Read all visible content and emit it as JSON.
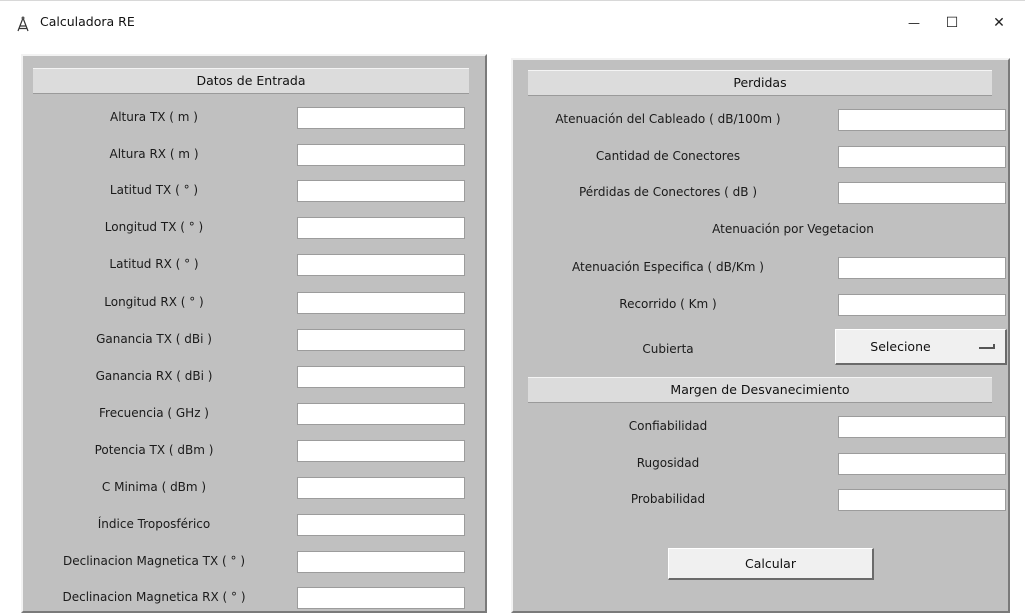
{
  "window": {
    "title": "Calculadora RE",
    "icon": "antenna-tower-icon",
    "controls": {
      "minimize": "—",
      "maximize": "☐",
      "close": "✕"
    }
  },
  "left_panel": {
    "header": "Datos de Entrada",
    "fields": [
      {
        "label": "Altura TX ( m )",
        "value": ""
      },
      {
        "label": "Altura RX ( m )",
        "value": ""
      },
      {
        "label": "Latitud TX ( ° )",
        "value": ""
      },
      {
        "label": "Longitud TX ( ° )",
        "value": ""
      },
      {
        "label": "Latitud RX ( ° )",
        "value": ""
      },
      {
        "label": "Longitud RX ( ° )",
        "value": ""
      },
      {
        "label": "Ganancia TX ( dBi )",
        "value": ""
      },
      {
        "label": "Ganancia RX ( dBi )",
        "value": ""
      },
      {
        "label": "Frecuencia ( GHz )",
        "value": ""
      },
      {
        "label": "Potencia TX ( dBm )",
        "value": ""
      },
      {
        "label": "C Minima  ( dBm )",
        "value": ""
      },
      {
        "label": "Índice Troposférico",
        "value": ""
      },
      {
        "label": "Declinacion Magnetica TX ( ° )",
        "value": ""
      },
      {
        "label": "Declinacion Magnetica RX ( ° )",
        "value": ""
      }
    ]
  },
  "right_panel": {
    "header": "Perdidas",
    "losses": [
      {
        "label": "Atenuación del Cableado ( dB/100m )",
        "value": ""
      },
      {
        "label": "Cantidad de Conectores",
        "value": ""
      },
      {
        "label": "Pérdidas de Conectores ( dB )",
        "value": ""
      }
    ],
    "vegetation_heading": "Atenuación por Vegetacion",
    "vegetation": [
      {
        "label": "Atenuación Especifica ( dB/Km )",
        "value": ""
      },
      {
        "label": "Recorrido ( Km )",
        "value": ""
      }
    ],
    "cover_label": "Cubierta",
    "cover_select": "Selecione",
    "fade_header": "Margen de Desvanecimiento",
    "fade": [
      {
        "label": "Confiabilidad",
        "value": ""
      },
      {
        "label": "Rugosidad",
        "value": ""
      },
      {
        "label": "Probabilidad",
        "value": ""
      }
    ],
    "calculate_button": "Calcular"
  }
}
